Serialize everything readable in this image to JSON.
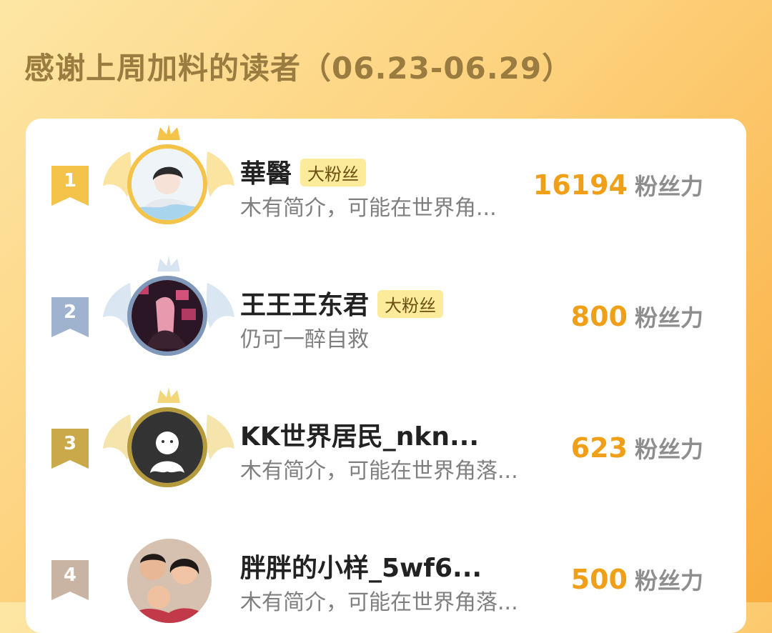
{
  "header": {
    "title": "感谢上周加料的读者（06.23-06.29）"
  },
  "colors": {
    "gold": "#f3c34a",
    "silver": "#9fb3cf",
    "bronze": "#c9a94a",
    "fourth": "#c9b3a2",
    "score": "#f0a018"
  },
  "readers": [
    {
      "rank": "1",
      "name": "華醫",
      "badge": "大粉丝",
      "desc": "木有简介，可能在世界角...",
      "score": "16194",
      "unit": "粉丝力",
      "avatar": "anime-boy-avatar"
    },
    {
      "rank": "2",
      "name": "王王王东君",
      "badge": "大粉丝",
      "desc": "仍可一醉自救",
      "score": "800",
      "unit": "粉丝力",
      "avatar": "neon-girl-avatar"
    },
    {
      "rank": "3",
      "name": "KK世界居民_nkn...",
      "desc": "木有简介，可能在世界角落...",
      "score": "623",
      "unit": "粉丝力",
      "avatar": "default-ghost-avatar"
    },
    {
      "rank": "4",
      "name": "胖胖的小样_5wf6...",
      "desc": "木有简介，可能在世界角落...",
      "score": "500",
      "unit": "粉丝力",
      "avatar": "family-photo-avatar"
    }
  ]
}
